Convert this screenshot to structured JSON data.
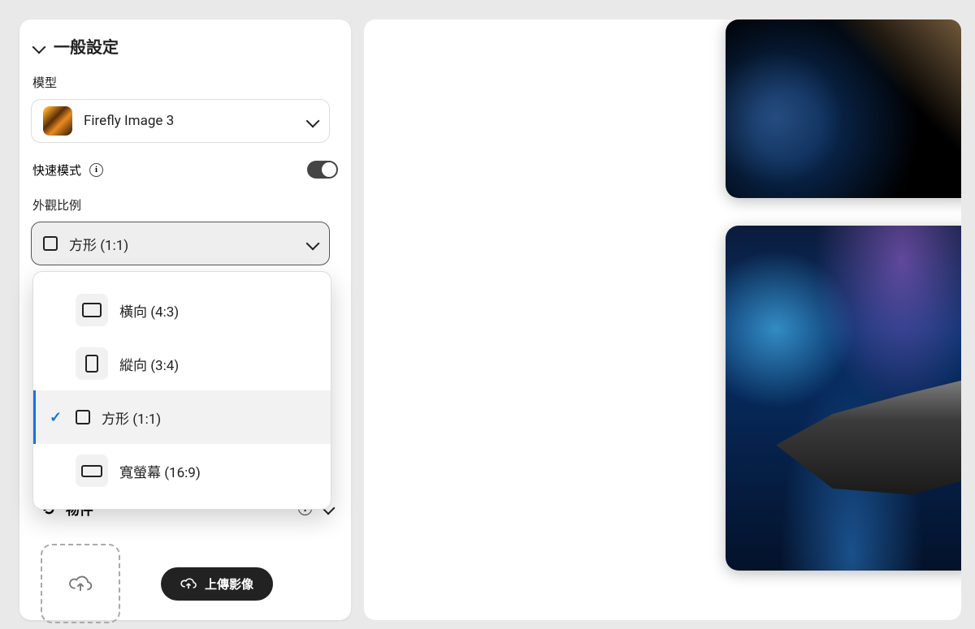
{
  "section": {
    "title": "一般設定"
  },
  "model": {
    "label": "模型",
    "value": "Firefly Image 3"
  },
  "fast": {
    "label": "快速模式",
    "on": true
  },
  "aspect": {
    "label": "外觀比例",
    "selected_label": "方形 (1:1)",
    "options": [
      {
        "label": "橫向 (4:3)",
        "shape": "land",
        "selected": false
      },
      {
        "label": "縱向 (3:4)",
        "shape": "port",
        "selected": false
      },
      {
        "label": "方形 (1:1)",
        "shape": "sq",
        "selected": true
      },
      {
        "label": "寬螢幕 (16:9)",
        "shape": "wide",
        "selected": false
      }
    ]
  },
  "objects": {
    "label": "物件"
  },
  "upload": {
    "button": "上傳影像"
  }
}
